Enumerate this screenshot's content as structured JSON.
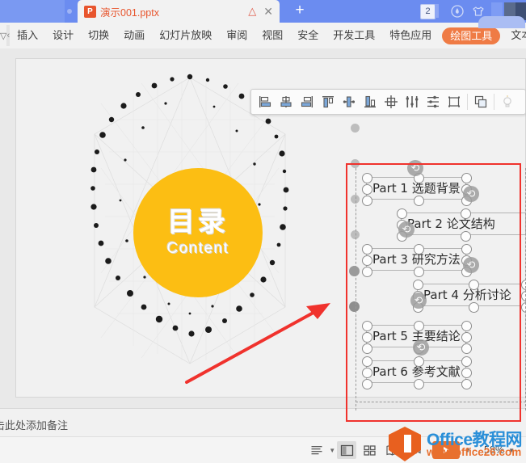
{
  "tabbar": {
    "file_tab": {
      "name": "演示001.pptx",
      "icon": "powerpoint-icon",
      "icon_letter": "P"
    },
    "warning_icon": "warning-triangle-icon",
    "close_icon": "close-icon",
    "new_tab_icon": "plus-icon",
    "notification_count": "2",
    "drop_icon": "water-drop-icon",
    "skin_icon": "t-shirt-skin-icon"
  },
  "ribbon": {
    "expand_icon": "chevron-down-icon",
    "scroll_prev_icon": "chevron-left-icon",
    "tabs": [
      {
        "label": "插入",
        "active": false
      },
      {
        "label": "设计",
        "active": false
      },
      {
        "label": "切换",
        "active": false
      },
      {
        "label": "动画",
        "active": false
      },
      {
        "label": "幻灯片放映",
        "active": false
      },
      {
        "label": "审阅",
        "active": false
      },
      {
        "label": "视图",
        "active": false
      },
      {
        "label": "安全",
        "active": false
      },
      {
        "label": "开发工具",
        "active": false
      },
      {
        "label": "特色应用",
        "active": false
      },
      {
        "label": "绘图工具",
        "active": true
      },
      {
        "label": "文本工",
        "active": false
      }
    ],
    "active_tab_color": "#ef7b45"
  },
  "align_toolbar": {
    "buttons": [
      "align-left-icon",
      "align-center-horizontal-icon",
      "align-right-icon",
      "align-top-icon",
      "align-middle-vertical-icon",
      "align-bottom-icon",
      "distribute-horizontally-icon",
      "distribute-vertically-icon",
      "align-relative-to-slide-icon",
      "group-icon",
      "duplicate-icon",
      "smart-guides-icon"
    ]
  },
  "slide": {
    "circle": {
      "title": "目录",
      "subtitle": "Content",
      "fill": "#fcbe13"
    },
    "text_items": [
      {
        "label": "Part 1  选题背景"
      },
      {
        "label": "Part 2  论文结构"
      },
      {
        "label": "Part 3  研究方法"
      },
      {
        "label": "Part 4  分析讨论"
      },
      {
        "label": "Part 5  主要结论"
      },
      {
        "label": "Part 6  参考文献"
      }
    ],
    "annotation": {
      "rect_color": "#f0322d",
      "arrow_color": "#f0322d",
      "arrow_icon": "red-arrow-icon"
    }
  },
  "notes": {
    "placeholder": "击此处添加备注"
  },
  "statusbar": {
    "outline_icon": "outline-view-icon",
    "views": [
      "normal-view-icon",
      "slide-sorter-icon",
      "reading-view-icon",
      "presenter-record-icon"
    ],
    "play_icon": "play-icon",
    "zoom_level": "58%"
  },
  "watermark": {
    "line1": "Office教程网",
    "line2": "www.office26.com",
    "logo_icon": "office-hexagon-logo-icon"
  }
}
